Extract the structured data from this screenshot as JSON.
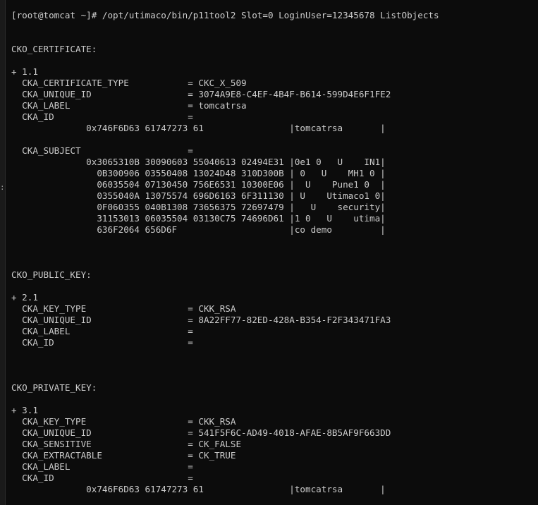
{
  "terminal": {
    "edge_mark": ":",
    "lines": [
      "[root@tomcat ~]# /opt/utimaco/bin/p11tool2 Slot=0 LoginUser=12345678 ListObjects",
      "",
      "",
      "CKO_CERTIFICATE:",
      "",
      "+ 1.1",
      "  CKA_CERTIFICATE_TYPE           = CKC_X_509",
      "  CKA_UNIQUE_ID                  = 3074A9E8-C4EF-4B4F-B614-599D4E6F1FE2",
      "  CKA_LABEL                      = tomcatrsa",
      "  CKA_ID                         =",
      "              0x746F6D63 61747273 61                |tomcatrsa       |",
      "",
      "  CKA_SUBJECT                    =",
      "              0x3065310B 30090603 55040613 02494E31 |0e1 0   U    IN1|",
      "                0B300906 03550408 13024D48 310D300B | 0   U    MH1 0 |",
      "                06035504 07130450 756E6531 10300E06 |  U    Pune1 0  |",
      "                0355040A 13075574 696D6163 6F311130 | U    Utimaco1 0|",
      "                0F060355 040B1308 73656375 72697479 |   U    security|",
      "                31153013 06035504 03130C75 74696D61 |1 0   U    utima|",
      "                636F2064 656D6F                     |co demo         |",
      "",
      "",
      "",
      "CKO_PUBLIC_KEY:",
      "",
      "+ 2.1",
      "  CKA_KEY_TYPE                   = CKK_RSA",
      "  CKA_UNIQUE_ID                  = 8A22FF77-82ED-428A-B354-F2F343471FA3",
      "  CKA_LABEL                      =",
      "  CKA_ID                         =",
      "",
      "",
      "",
      "CKO_PRIVATE_KEY:",
      "",
      "+ 3.1",
      "  CKA_KEY_TYPE                   = CKK_RSA",
      "  CKA_UNIQUE_ID                  = 541F5F6C-AD49-4018-AFAE-8B5AF9F663DD",
      "  CKA_SENSITIVE                  = CK_FALSE",
      "  CKA_EXTRACTABLE                = CK_TRUE",
      "  CKA_LABEL                      =",
      "  CKA_ID                         =",
      "              0x746F6D63 61747273 61                |tomcatrsa       |"
    ]
  },
  "colors": {
    "background": "#0c0c0c",
    "foreground": "#cccccc",
    "edge": "#1a1a1a"
  }
}
